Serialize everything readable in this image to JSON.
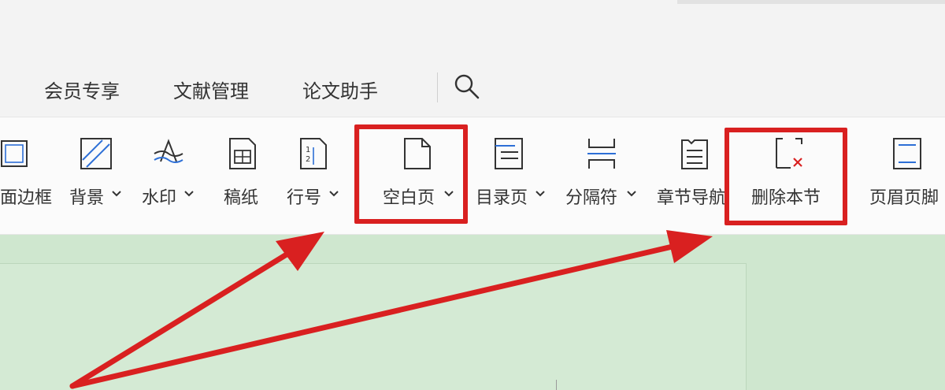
{
  "menu": {
    "tabs": [
      {
        "label": "会员专享"
      },
      {
        "label": "文献管理"
      },
      {
        "label": "论文助手"
      }
    ],
    "search_icon": "search-icon"
  },
  "ribbon": {
    "tools": [
      {
        "label": "面边框",
        "icon": "page-border-icon",
        "has_dropdown": false
      },
      {
        "label": "背景",
        "icon": "background-icon",
        "has_dropdown": true
      },
      {
        "label": "水印",
        "icon": "watermark-icon",
        "has_dropdown": true
      },
      {
        "label": "稿纸",
        "icon": "manuscript-paper-icon",
        "has_dropdown": false
      },
      {
        "label": "行号",
        "icon": "line-number-icon",
        "has_dropdown": true
      },
      {
        "label": "空白页",
        "icon": "blank-page-icon",
        "has_dropdown": true
      },
      {
        "label": "目录页",
        "icon": "toc-page-icon",
        "has_dropdown": true
      },
      {
        "label": "分隔符",
        "icon": "separator-icon",
        "has_dropdown": true
      },
      {
        "label": "章节导航",
        "icon": "chapter-nav-icon",
        "has_dropdown": false
      },
      {
        "label": "删除本节",
        "icon": "delete-section-icon",
        "has_dropdown": false
      },
      {
        "label": "页眉页脚",
        "icon": "header-footer-icon",
        "has_dropdown": false
      }
    ]
  },
  "annotations": {
    "highlight_color": "#d92020",
    "arrow_color": "#d92020"
  }
}
